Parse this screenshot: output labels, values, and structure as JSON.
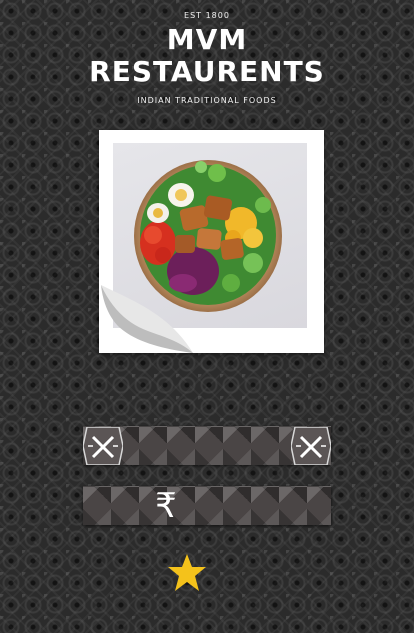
{
  "header": {
    "est": "EST 1800",
    "title_line1": "MVM",
    "title_line2": "RESTAURENTS",
    "subtitle": "INDIAN TRADITIONAL FOODS"
  },
  "photo": {
    "subject": "salad bowl with grilled chicken, egg, tomatoes, corn and red cabbage"
  },
  "buttons": {
    "menu_icon": "fork-knife-icon",
    "price_symbol": "₹"
  },
  "rating": {
    "icon": "star-icon",
    "color": "#f4c21b"
  },
  "colors": {
    "background": "#2b2b2b",
    "strip": "#4a4545",
    "star": "#f4c21b",
    "text": "#ffffff"
  }
}
